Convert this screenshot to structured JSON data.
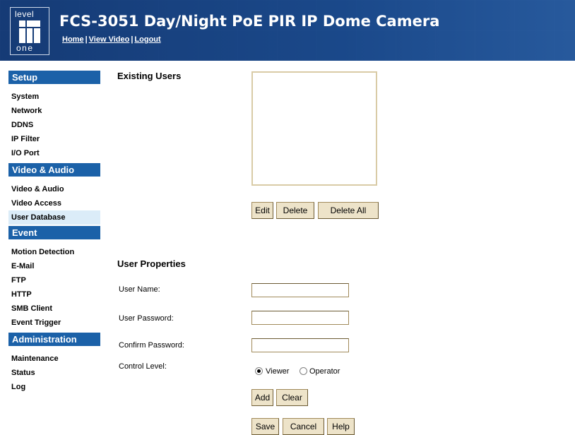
{
  "header": {
    "logo_top": "level",
    "logo_bottom": "one",
    "title": "FCS-3051 Day/Night PoE PIR IP Dome Camera",
    "nav": [
      "Home",
      "View Video",
      "Logout"
    ]
  },
  "sidebar": {
    "sections": [
      {
        "title": "Setup",
        "items": [
          "System",
          "Network",
          "DDNS",
          "IP Filter",
          "I/O Port"
        ]
      },
      {
        "title": "Video & Audio",
        "items": [
          "Video & Audio",
          "Video Access",
          "User Database"
        ]
      },
      {
        "title": "Event",
        "items": [
          "Motion Detection",
          "E-Mail",
          "FTP",
          "HTTP",
          "SMB Client",
          "Event Trigger"
        ]
      },
      {
        "title": "Administration",
        "items": [
          "Maintenance",
          "Status",
          "Log"
        ]
      }
    ],
    "active_item": "User Database"
  },
  "existing_users": {
    "heading": "Existing Users",
    "buttons": {
      "edit": "Edit",
      "delete": "Delete",
      "delete_all": "Delete All"
    }
  },
  "user_properties": {
    "heading": "User Properties",
    "user_name_label": "User Name:",
    "user_name_value": "",
    "user_password_label": "User Password:",
    "user_password_value": "",
    "confirm_password_label": "Confirm Password:",
    "confirm_password_value": "",
    "control_level_label": "Control Level:",
    "control_options": [
      "Viewer",
      "Operator"
    ],
    "control_selected": "Viewer",
    "buttons": {
      "add": "Add",
      "clear": "Clear"
    }
  },
  "footer_buttons": {
    "save": "Save",
    "cancel": "Cancel",
    "help": "Help"
  },
  "colors": {
    "header_bg": "#17407e",
    "section_bg": "#1b61a8",
    "active_bg": "#dbecf8",
    "button_bg": "#ede3c9"
  }
}
